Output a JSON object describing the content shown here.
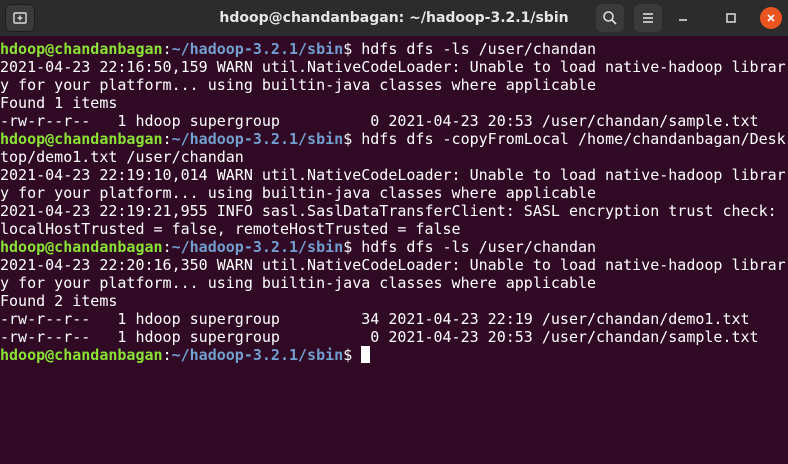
{
  "window": {
    "title": "hdoop@chandanbagan: ~/hadoop-3.2.1/sbin"
  },
  "colors": {
    "background": "#300a24",
    "titlebar": "#2c2c2c",
    "prompt_user": "#8ae234",
    "prompt_path": "#729fcf",
    "close_button": "#e95420"
  },
  "icons": {
    "new_tab": "new-tab-icon",
    "search": "search-icon",
    "menu": "hamburger-menu-icon",
    "minimize": "minimize-icon",
    "maximize": "maximize-icon",
    "close": "close-icon"
  },
  "prompt": {
    "user_host": "hdoop@chandanbagan",
    "colon": ":",
    "path": "~/hadoop-3.2.1/sbin",
    "dollar": "$"
  },
  "lines": [
    {
      "type": "prompt",
      "cmd": " hdfs dfs -ls /user/chandan"
    },
    {
      "type": "text",
      "text": "2021-04-23 22:16:50,159 WARN util.NativeCodeLoader: Unable to load native-hadoop librar"
    },
    {
      "type": "text",
      "text": "y for your platform... using builtin-java classes where applicable"
    },
    {
      "type": "text",
      "text": "Found 1 items"
    },
    {
      "type": "text",
      "text": "-rw-r--r--   1 hdoop supergroup          0 2021-04-23 20:53 /user/chandan/sample.txt"
    },
    {
      "type": "prompt",
      "cmd": " hdfs dfs -copyFromLocal /home/chandanbagan/Desk"
    },
    {
      "type": "text",
      "text": "top/demo1.txt /user/chandan"
    },
    {
      "type": "text",
      "text": "2021-04-23 22:19:10,014 WARN util.NativeCodeLoader: Unable to load native-hadoop librar"
    },
    {
      "type": "text",
      "text": "y for your platform... using builtin-java classes where applicable"
    },
    {
      "type": "text",
      "text": "2021-04-23 22:19:21,955 INFO sasl.SaslDataTransferClient: SASL encryption trust check:"
    },
    {
      "type": "text",
      "text": "localHostTrusted = false, remoteHostTrusted = false"
    },
    {
      "type": "prompt",
      "cmd": " hdfs dfs -ls /user/chandan"
    },
    {
      "type": "text",
      "text": "2021-04-23 22:20:16,350 WARN util.NativeCodeLoader: Unable to load native-hadoop librar"
    },
    {
      "type": "text",
      "text": "y for your platform... using builtin-java classes where applicable"
    },
    {
      "type": "text",
      "text": "Found 2 items"
    },
    {
      "type": "text",
      "text": "-rw-r--r--   1 hdoop supergroup         34 2021-04-23 22:19 /user/chandan/demo1.txt"
    },
    {
      "type": "text",
      "text": "-rw-r--r--   1 hdoop supergroup          0 2021-04-23 20:53 /user/chandan/sample.txt"
    },
    {
      "type": "prompt",
      "cmd": " ",
      "cursor": true
    }
  ]
}
